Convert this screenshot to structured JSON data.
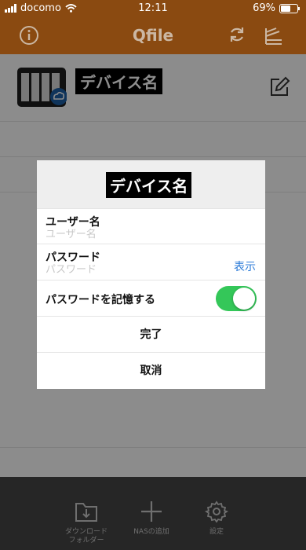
{
  "status": {
    "carrier": "docomo",
    "time": "12:11",
    "battery": "69%",
    "battery_level": 0.69
  },
  "header": {
    "title": "Qfile",
    "info_icon": "info-icon",
    "refresh_icon": "refresh-icon",
    "sort_icon": "sort-icon"
  },
  "device": {
    "name": "デバイス名",
    "nas_icon": "nas-device-icon",
    "cloud_badge": "cloud-icon",
    "edit_icon": "edit-icon"
  },
  "dialog": {
    "title": "デバイス名",
    "username_label": "ユーザー名",
    "username_placeholder": "ユーザー名",
    "password_label": "パスワード",
    "password_placeholder": "パスワード",
    "show_label": "表示",
    "remember_label": "パスワードを記憶する",
    "remember_on": true,
    "done_label": "完了",
    "cancel_label": "取消"
  },
  "tabs": [
    {
      "label": "ダウンロード\nフォルダー",
      "icon": "download-folder-icon"
    },
    {
      "label": "NASの追加",
      "icon": "plus-icon"
    },
    {
      "label": "設定",
      "icon": "gear-icon"
    }
  ],
  "colors": {
    "nav": "#8a4a11",
    "toggle_on": "#34c759",
    "link": "#2c7bd8",
    "tabbar": "#262626"
  }
}
